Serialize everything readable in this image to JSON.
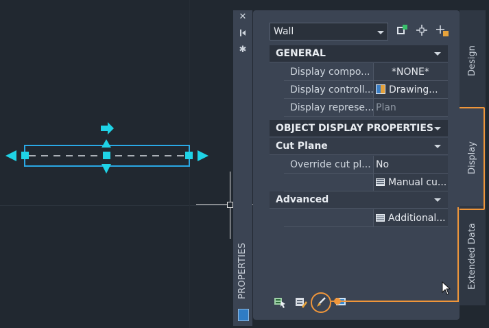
{
  "palette": {
    "strip_title": "PROPERTIES",
    "object_type": "Wall",
    "tabs": [
      {
        "label": "Design",
        "active": false
      },
      {
        "label": "Display",
        "active": true
      },
      {
        "label": "Extended Data",
        "active": false
      }
    ],
    "sections": {
      "general": {
        "title": "GENERAL",
        "rows": [
          {
            "key": "Display compo...",
            "value": "*NONE*"
          },
          {
            "key": "Display controll...",
            "value": "Drawing..."
          },
          {
            "key": "Display represe...",
            "value": "Plan"
          }
        ]
      },
      "object_display": {
        "title": "OBJECT DISPLAY PROPERTIES"
      },
      "cut_plane": {
        "title": "Cut Plane",
        "rows": [
          {
            "key": "Override cut pl...",
            "value": "No"
          },
          {
            "key": "",
            "value": "Manual cu..."
          }
        ]
      },
      "advanced": {
        "title": "Advanced",
        "rows": [
          {
            "key": "",
            "value": "Additional..."
          }
        ]
      }
    }
  },
  "colors": {
    "highlight": "#f0963a",
    "grip": "#1fd3e6",
    "canvas_bg": "#212830",
    "panel_bg": "#3b4453"
  },
  "icons": [
    "close-icon",
    "autohide-icon",
    "settings-icon",
    "quick-select-icon",
    "pickadd-icon",
    "select-objects-icon",
    "add-selected-icon",
    "edit-style-icon",
    "brush-icon",
    "display-manager-icon"
  ]
}
